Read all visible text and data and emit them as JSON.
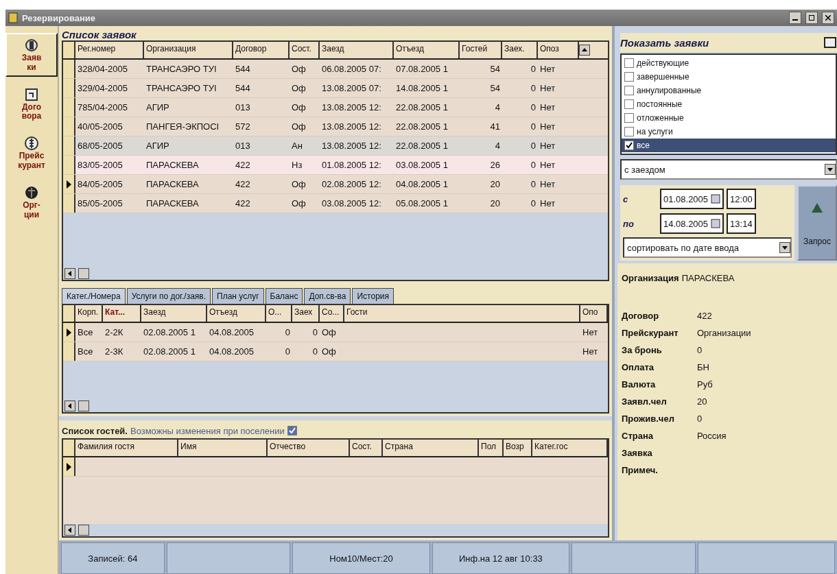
{
  "window": {
    "title": "Резервирование"
  },
  "sidebar": {
    "items": [
      {
        "label": "Заяв\nки",
        "selected": true
      },
      {
        "label": "Дого\nвора",
        "selected": false
      },
      {
        "label": "Прейс\nкурант",
        "selected": false
      },
      {
        "label": "Орг-\nции",
        "selected": false
      }
    ]
  },
  "orders": {
    "title": "Список заявок",
    "columns": [
      "Рег.номер",
      "Организация",
      "Договор",
      "Сост.",
      "Заезд",
      "Отъезд",
      "Гостей",
      "Заех.",
      "Опоз"
    ],
    "rows": [
      {
        "cells": [
          "328/04-2005",
          "ТРАНСАЭРО ТУІ",
          "544",
          "Оф",
          "06.08.2005 07:",
          "07.08.2005 1",
          "54",
          "0",
          "Нет"
        ],
        "color": "#e9dccf",
        "selected": false
      },
      {
        "cells": [
          "329/04-2005",
          "ТРАНСАЭРО ТУІ",
          "544",
          "Оф",
          "13.08.2005 07:",
          "14.08.2005 1",
          "54",
          "0",
          "Нет"
        ],
        "color": "#e9dccf",
        "selected": false
      },
      {
        "cells": [
          "785/04-2005",
          "АГИР",
          "013",
          "Оф",
          "13.08.2005 12:",
          "22.08.2005 1",
          "4",
          "0",
          "Нет"
        ],
        "color": "#e9dccf",
        "selected": false
      },
      {
        "cells": [
          "40/05-2005",
          "ПАНГЕЯ-ЭКПОСІ",
          "572",
          "Оф",
          "13.08.2005 12:",
          "22.08.2005 1",
          "41",
          "0",
          "Нет"
        ],
        "color": "#e9dccf",
        "selected": false
      },
      {
        "cells": [
          "68/05-2005",
          "АГИР",
          "013",
          "Ан",
          "13.08.2005 12:",
          "22.08.2005 1",
          "4",
          "0",
          "Нет"
        ],
        "color": "#dcd8d4",
        "selected": false
      },
      {
        "cells": [
          "83/05-2005",
          "ПАРАСКЕВА",
          "422",
          "Нз",
          "01.08.2005 12:",
          "03.08.2005 1",
          "26",
          "0",
          "Нет"
        ],
        "color": "#f8e6e6",
        "selected": false
      },
      {
        "cells": [
          "84/05-2005",
          "ПАРАСКЕВА",
          "422",
          "Оф",
          "02.08.2005 12:",
          "04.08.2005 1",
          "20",
          "0",
          "Нет"
        ],
        "color": "#e9dccf",
        "selected": true
      },
      {
        "cells": [
          "85/05-2005",
          "ПАРАСКЕВА",
          "422",
          "Оф",
          "03.08.2005 12:",
          "05.08.2005 1",
          "20",
          "0",
          "Нет"
        ],
        "color": "#e9dccf",
        "selected": false
      }
    ]
  },
  "tabs": [
    {
      "label": "Катег./Номера",
      "selected": true
    },
    {
      "label": "Услуги по дог./заяв.",
      "selected": false
    },
    {
      "label": "План услуг",
      "selected": false
    },
    {
      "label": "Баланс",
      "selected": false
    },
    {
      "label": "Доп.св-ва",
      "selected": false
    },
    {
      "label": "История",
      "selected": false
    }
  ],
  "rooms": {
    "columns": [
      {
        "label": "Корп.",
        "sorted": false
      },
      {
        "label": "Кат...",
        "sorted": true
      },
      {
        "label": "Заезд",
        "sorted": false
      },
      {
        "label": "Отъезд",
        "sorted": false
      },
      {
        "label": "О...",
        "sorted": false
      },
      {
        "label": "Заех",
        "sorted": false
      },
      {
        "label": "Со...",
        "sorted": false
      },
      {
        "label": "Гости",
        "sorted": false
      },
      {
        "label": "Опо",
        "sorted": false
      }
    ],
    "rows": [
      {
        "cells": [
          "Все",
          "2-2К",
          "02.08.2005 1",
          "04.08.2005",
          "0",
          "0",
          "Оф",
          "",
          "Нет"
        ],
        "selected": true
      },
      {
        "cells": [
          "Все",
          "2-3К",
          "02.08.2005 1",
          "04.08.2005",
          "0",
          "0",
          "Оф",
          "",
          "Нет"
        ],
        "selected": false
      }
    ]
  },
  "guests": {
    "title": "Список гостей.",
    "note": "Возможны изменения при поселении",
    "note_checked": true,
    "columns": [
      "Фамилия гостя",
      "Имя",
      "Отчество",
      "Сост.",
      "Страна",
      "Пол",
      "Возр",
      "Катег.гос"
    ]
  },
  "filter": {
    "title": "Показать заявки",
    "options": [
      {
        "label": "действующие",
        "checked": false,
        "selected": false
      },
      {
        "label": "завершенные",
        "checked": false,
        "selected": false
      },
      {
        "label": "аннулированные",
        "checked": false,
        "selected": false
      },
      {
        "label": "постоянные",
        "checked": false,
        "selected": false
      },
      {
        "label": "отложенные",
        "checked": false,
        "selected": false
      },
      {
        "label": "на услуги",
        "checked": false,
        "selected": false
      },
      {
        "label": "все",
        "checked": true,
        "selected": true
      }
    ],
    "mode": "с заездом",
    "from": {
      "label": "с",
      "date": "01.08.2005",
      "time": "12:00"
    },
    "to": {
      "label": "по",
      "date": "14.08.2005",
      "time": "13:14"
    },
    "sort": "сортировать по дате ввода",
    "query_button": "Запрос"
  },
  "info": {
    "organization": {
      "label": "Организация",
      "value": "ПАРАСКЕВА"
    },
    "fields": [
      {
        "label": "Договор",
        "value": "422"
      },
      {
        "label": "Прейскурант",
        "value": "Организации"
      },
      {
        "label": "За бронь",
        "value": "0"
      },
      {
        "label": "Оплата",
        "value": "БН"
      },
      {
        "label": "Валюта",
        "value": "Руб"
      },
      {
        "label": "Заявл.чел",
        "value": "20"
      },
      {
        "label": "Прожив.чел",
        "value": "0"
      },
      {
        "label": "Страна",
        "value": "Россия"
      },
      {
        "label": "Заявка"
      },
      {
        "label": "Примеч."
      }
    ]
  },
  "status_bar": [
    "Записей: 64",
    "Ном10/Мест:20",
    "Инф.на 12 авг 10:33"
  ]
}
